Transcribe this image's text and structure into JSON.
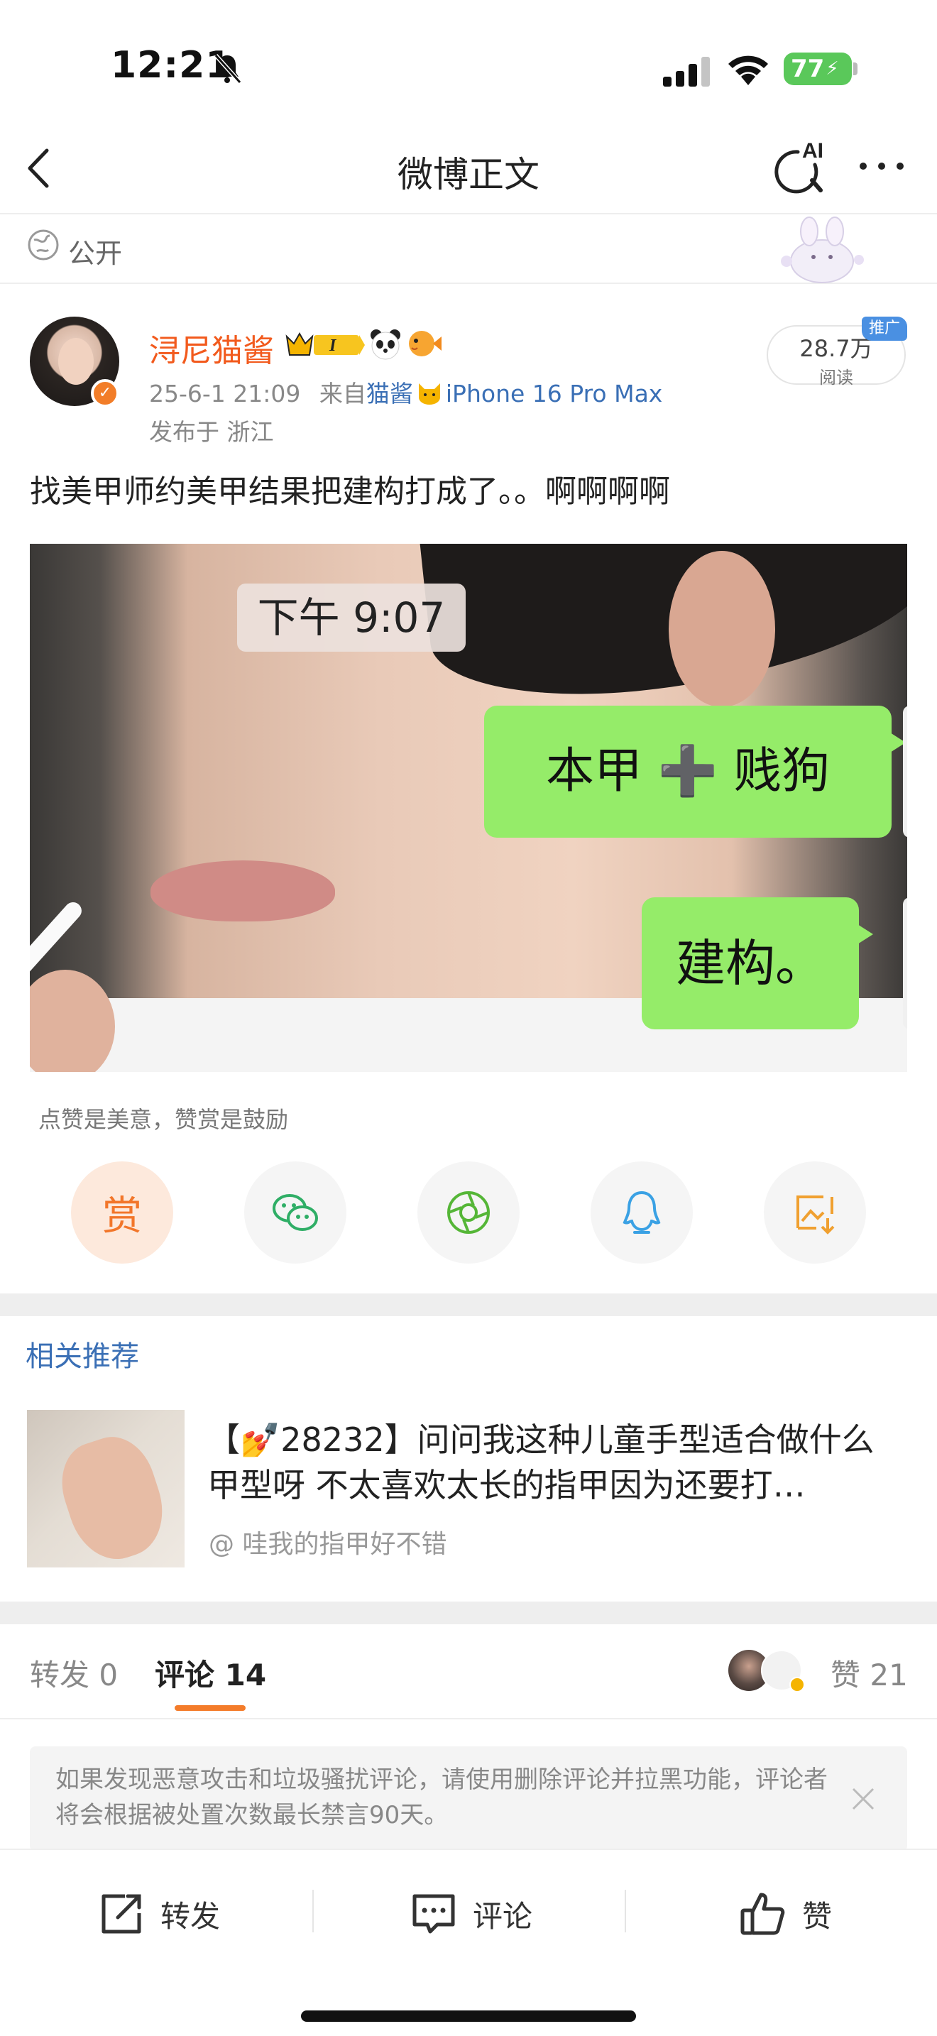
{
  "status_bar": {
    "time": "12:21",
    "battery": "77"
  },
  "nav": {
    "title": "微博正文"
  },
  "visibility": {
    "label": "公开"
  },
  "post": {
    "username": "浔尼猫酱",
    "timestamp": "25-6-1 21:09",
    "source_prefix": "来自",
    "source_name": "猫酱",
    "device": "iPhone 16 Pro Max",
    "location": "发布于 浙江",
    "read_count": "28.7万",
    "read_label": "阅读",
    "promo_tag": "推广",
    "text": "找美甲师约美甲结果把建构打成了。。啊啊啊啊",
    "image": {
      "time_chip": "下午 9:07",
      "bubble_1": "本甲 ➕ 贱狗",
      "bubble_2": "建构。"
    }
  },
  "reward": {
    "hint": "点赞是美意，赞赏是鼓励",
    "button_label": "赏"
  },
  "share_targets": [
    "reward",
    "wechat-icon",
    "moments-icon",
    "qq-icon",
    "save-image-icon"
  ],
  "related": {
    "heading": "相关推荐",
    "title": "【💅28232】问问我这种儿童手型适合做什么甲型呀 不太喜欢太长的指甲因为还要打…",
    "author": "@ 哇我的指甲好不错"
  },
  "tabs": {
    "repost": "转发 0",
    "comment": "评论 14",
    "likes": "赞 21"
  },
  "notice": {
    "text": "如果发现恶意攻击和垃圾骚扰评论，请使用删除评论并拉黑功能，评论者将会根据被处置次数最长禁言90天。"
  },
  "bottom_actions": {
    "repost": "转发",
    "comment": "评论",
    "like": "赞"
  },
  "colors": {
    "accent": "#f47c2a",
    "link": "#3a6fb5",
    "username": "#f25a1d",
    "chat_bubble": "#95ec69"
  }
}
